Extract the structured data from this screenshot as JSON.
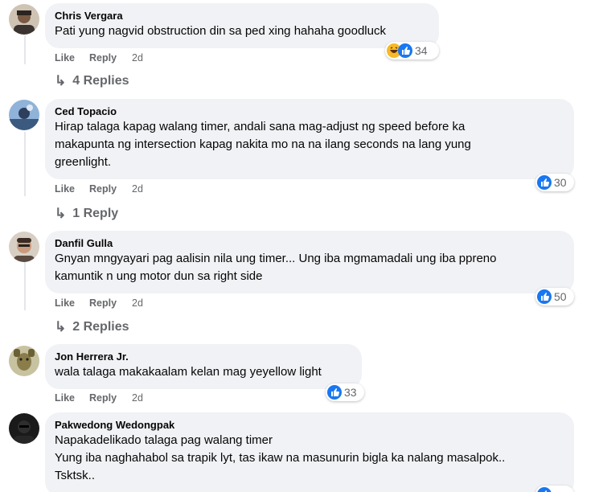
{
  "actions": {
    "like": "Like",
    "reply": "Reply"
  },
  "colors": {
    "bubble": "#f0f2f5",
    "like_blue": "#1877f2",
    "haha_yellow": "#f7b928",
    "muted": "#65676b"
  },
  "comments": [
    {
      "author": "Chris Vergara",
      "text": "Pati yung nagvid obstruction din sa ped xing hahaha goodluck",
      "time": "2d",
      "reactions": [
        "haha-icon",
        "like-icon"
      ],
      "reaction_count": "34",
      "replies": "4 Replies"
    },
    {
      "author": "Ced Topacio",
      "text": "Hirap talaga kapag walang timer, andali sana mag-adjust ng speed before ka\nmakapunta ng intersection kapag nakita mo na na ilang seconds na lang yung\ngreenlight.",
      "time": "2d",
      "reactions": [
        "like-icon"
      ],
      "reaction_count": "30",
      "replies": "1 Reply"
    },
    {
      "author": "Danfil Gulla",
      "text": "Gnyan mngyayari pag aalisin nila ung timer... Ung iba mgmamadali ung iba ppreno\nkamuntik n ung motor dun sa right side",
      "time": "2d",
      "reactions": [
        "like-icon"
      ],
      "reaction_count": "50",
      "replies": "2 Replies"
    },
    {
      "author": "Jon Herrera Jr.",
      "text": "wala talaga makakaalam kelan mag yeyellow light",
      "time": "2d",
      "reactions": [
        "like-icon"
      ],
      "reaction_count": "33",
      "replies": ""
    },
    {
      "author": "Pakwedong Wedongpak",
      "text": "Napakadelikado talaga pag walang timer\nYung iba naghahabol sa trapik lyt, tas ikaw na masunurin bigla ka nalang masalpok..\nTsktsk..",
      "time": "",
      "reactions": [
        "like-icon"
      ],
      "reaction_count": "",
      "replies": ""
    }
  ]
}
